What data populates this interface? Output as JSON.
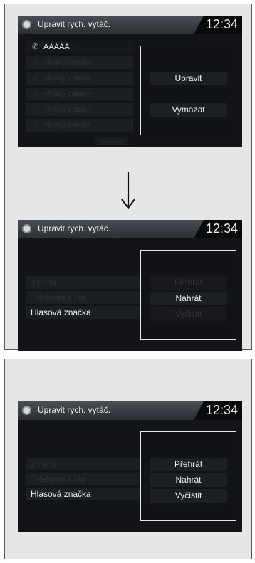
{
  "common": {
    "title": "Upravit rych. vytáč.",
    "clock": "12:34"
  },
  "screen1": {
    "entries": [
      {
        "label": "AAAAA",
        "icon": "phone-icon",
        "active": true
      },
      {
        "label": "<Nový vstup>",
        "icon": "check-icon",
        "active": false
      },
      {
        "label": "<Nový vstup>",
        "icon": "check-icon",
        "active": false
      },
      {
        "label": "<Nový vstup>",
        "icon": "check-icon",
        "active": false
      },
      {
        "label": "<Nový vstup>",
        "icon": "check-icon",
        "active": false
      },
      {
        "label": "<Nový vstup>",
        "icon": "check-icon",
        "active": false
      }
    ],
    "ghost_button": "Vymazat",
    "menu": {
      "edit_label": "Upravit",
      "delete_label": "Vymazat"
    }
  },
  "screen2": {
    "fields": {
      "name_label": "Jméno",
      "phone_label": "Telefonní číslo",
      "voice_tag_label": "Hlasová značka"
    },
    "menu": {
      "play_label": "Přehrát",
      "record_label": "Nahrát",
      "clear_label": "Vyčistit"
    },
    "enabled": {
      "play": false,
      "record": true,
      "clear": false
    }
  },
  "screen3": {
    "fields": {
      "name_label": "Jméno",
      "phone_label": "Telefonní číslo",
      "voice_tag_label": "Hlasová značka"
    },
    "menu": {
      "play_label": "Přehrát",
      "record_label": "Nahrát",
      "clear_label": "Vyčistit"
    },
    "enabled": {
      "play": true,
      "record": true,
      "clear": true
    }
  },
  "colors": {
    "panel_bg": "#e6e6e6",
    "screen_bg": "#121417",
    "text_active": "#f1f1f1",
    "text_disabled": "#33363b"
  }
}
